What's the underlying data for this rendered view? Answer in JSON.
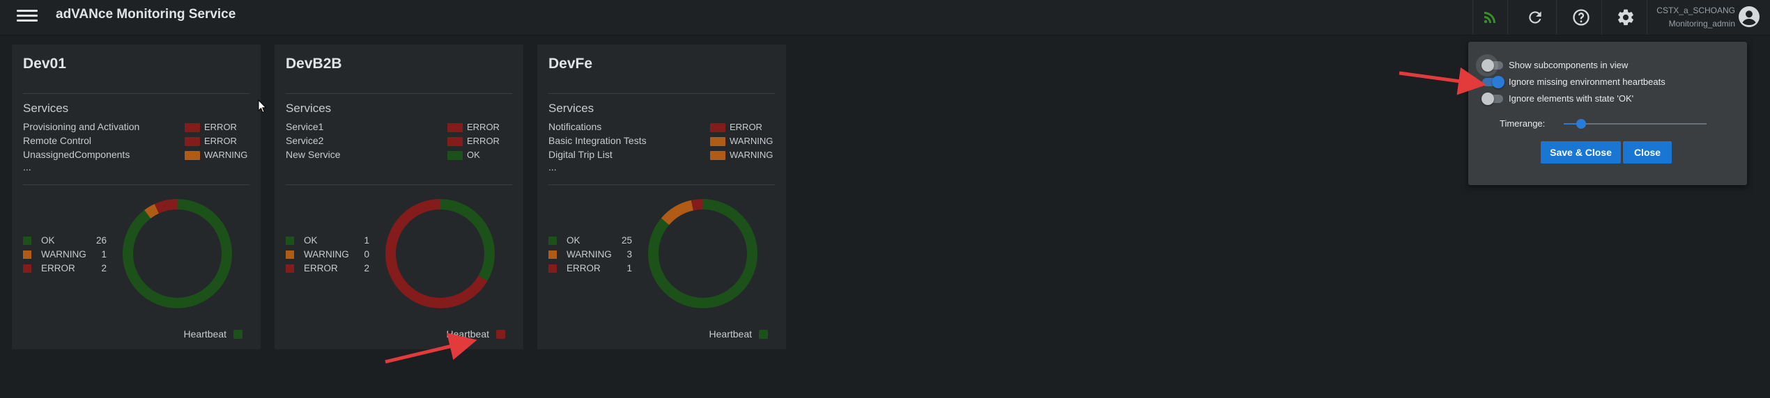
{
  "app": {
    "title": "adVANce Monitoring Service"
  },
  "user": {
    "name": "CSTX_a_SCHOANG",
    "role": "Monitoring_admin"
  },
  "toolbar": {
    "icons": [
      "menu-icon",
      "rss-feed-icon",
      "refresh-icon",
      "help-icon",
      "settings-gear-icon",
      "account-circle-icon"
    ]
  },
  "colors": {
    "ok": "#1c5219",
    "warning": "#b05c17",
    "error": "#841c1c",
    "accent": "#1976d2",
    "feed_icon": "#3a8e2a"
  },
  "cards": [
    {
      "name": "Dev01",
      "services_title": "Services",
      "services": [
        {
          "name": "Provisioning and Activation",
          "status": "ERROR"
        },
        {
          "name": "Remote Control",
          "status": "ERROR"
        },
        {
          "name": "UnassignedComponents",
          "status": "WARNING"
        }
      ],
      "more": "...",
      "legend": [
        {
          "label": "OK",
          "count": "26"
        },
        {
          "label": "WARNING",
          "count": "1"
        },
        {
          "label": "ERROR",
          "count": "2"
        }
      ],
      "heartbeat_label": "Heartbeat",
      "heartbeat_status": "OK"
    },
    {
      "name": "DevB2B",
      "services_title": "Services",
      "services": [
        {
          "name": "Service1",
          "status": "ERROR"
        },
        {
          "name": "Service2",
          "status": "ERROR"
        },
        {
          "name": "New Service",
          "status": "OK"
        }
      ],
      "more": "",
      "legend": [
        {
          "label": "OK",
          "count": "1"
        },
        {
          "label": "WARNING",
          "count": "0"
        },
        {
          "label": "ERROR",
          "count": "2"
        }
      ],
      "heartbeat_label": "Heartbeat",
      "heartbeat_status": "ERROR"
    },
    {
      "name": "DevFe",
      "services_title": "Services",
      "services": [
        {
          "name": "Notifications",
          "status": "ERROR"
        },
        {
          "name": "Basic Integration Tests",
          "status": "WARNING"
        },
        {
          "name": "Digital Trip List",
          "status": "WARNING"
        }
      ],
      "more": "...",
      "legend": [
        {
          "label": "OK",
          "count": "25"
        },
        {
          "label": "WARNING",
          "count": "3"
        },
        {
          "label": "ERROR",
          "count": "1"
        }
      ],
      "heartbeat_label": "Heartbeat",
      "heartbeat_status": "OK"
    }
  ],
  "settings": {
    "options": [
      {
        "label": "Show subcomponents in view",
        "checked": false,
        "focused": true
      },
      {
        "label": "Ignore missing environment heartbeats",
        "checked": true,
        "focused": false
      },
      {
        "label": "Ignore elements with state 'OK'",
        "checked": false,
        "focused": false
      }
    ],
    "timerange_label": "Timerange:",
    "timerange_value": 0.12,
    "save_close_label": "Save & Close",
    "close_label": "Close"
  }
}
